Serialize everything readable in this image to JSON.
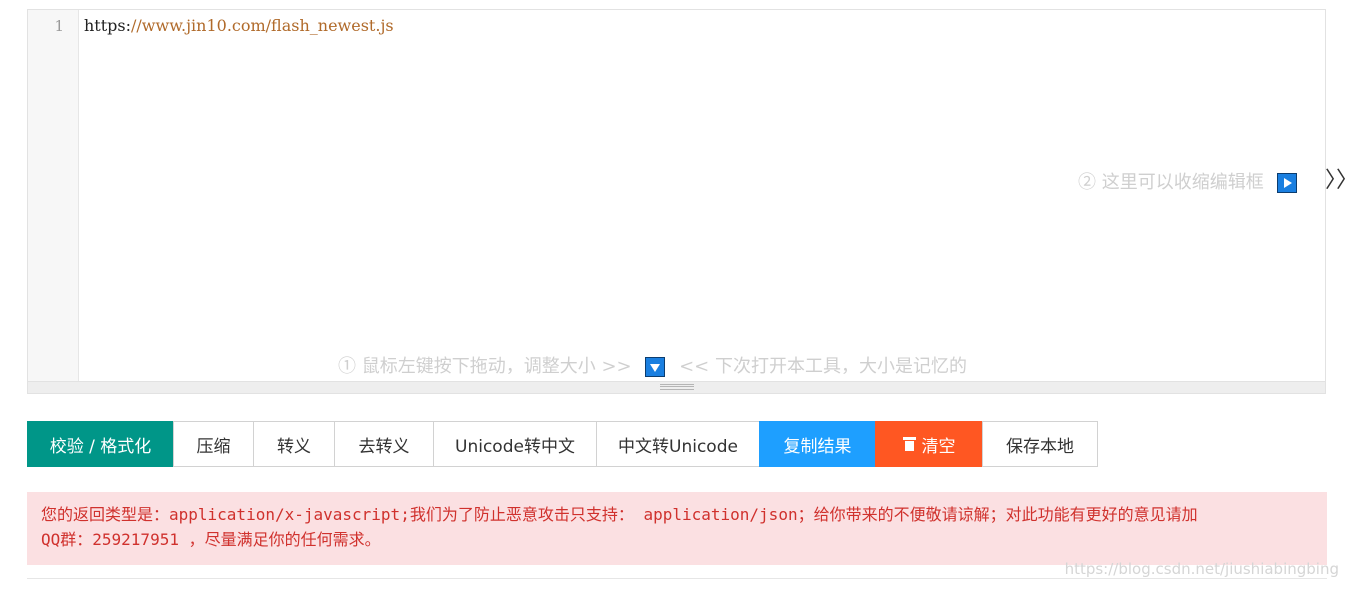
{
  "editor": {
    "line_number": "1",
    "code_prefix": "https:",
    "code_string": "//www.jin10.com/flash_newest.js",
    "hint_collapse": "② 这里可以收缩编辑框",
    "hint_resize_left": "① 鼠标左键按下拖动，调整大小 >>",
    "hint_resize_right": "<< 下次打开本工具，大小是记忆的",
    "expand_chevron": "〉〉"
  },
  "toolbar": {
    "buttons": [
      {
        "label": "校验 / 格式化"
      },
      {
        "label": "压缩"
      },
      {
        "label": "转义"
      },
      {
        "label": "去转义"
      },
      {
        "label": "Unicode转中文"
      },
      {
        "label": "中文转Unicode"
      },
      {
        "label": "复制结果"
      },
      {
        "label": "清空"
      },
      {
        "label": "保存本地"
      }
    ]
  },
  "alert": {
    "line1": "您的返回类型是：application/x-javascript;我们为了防止恶意攻击只支持： application/json；给你带来的不便敬请谅解；对此功能有更好的意见请加",
    "line2": "QQ群：259217951 ，尽量满足你的任何需求。"
  },
  "watermark": "https://blog.csdn.net/jiushiabingbing",
  "colors": {
    "primary": "#009688",
    "blue": "#1e9fff",
    "orange": "#ff5722",
    "alert_bg": "#fbe0e2",
    "alert_text": "#d0312d"
  }
}
